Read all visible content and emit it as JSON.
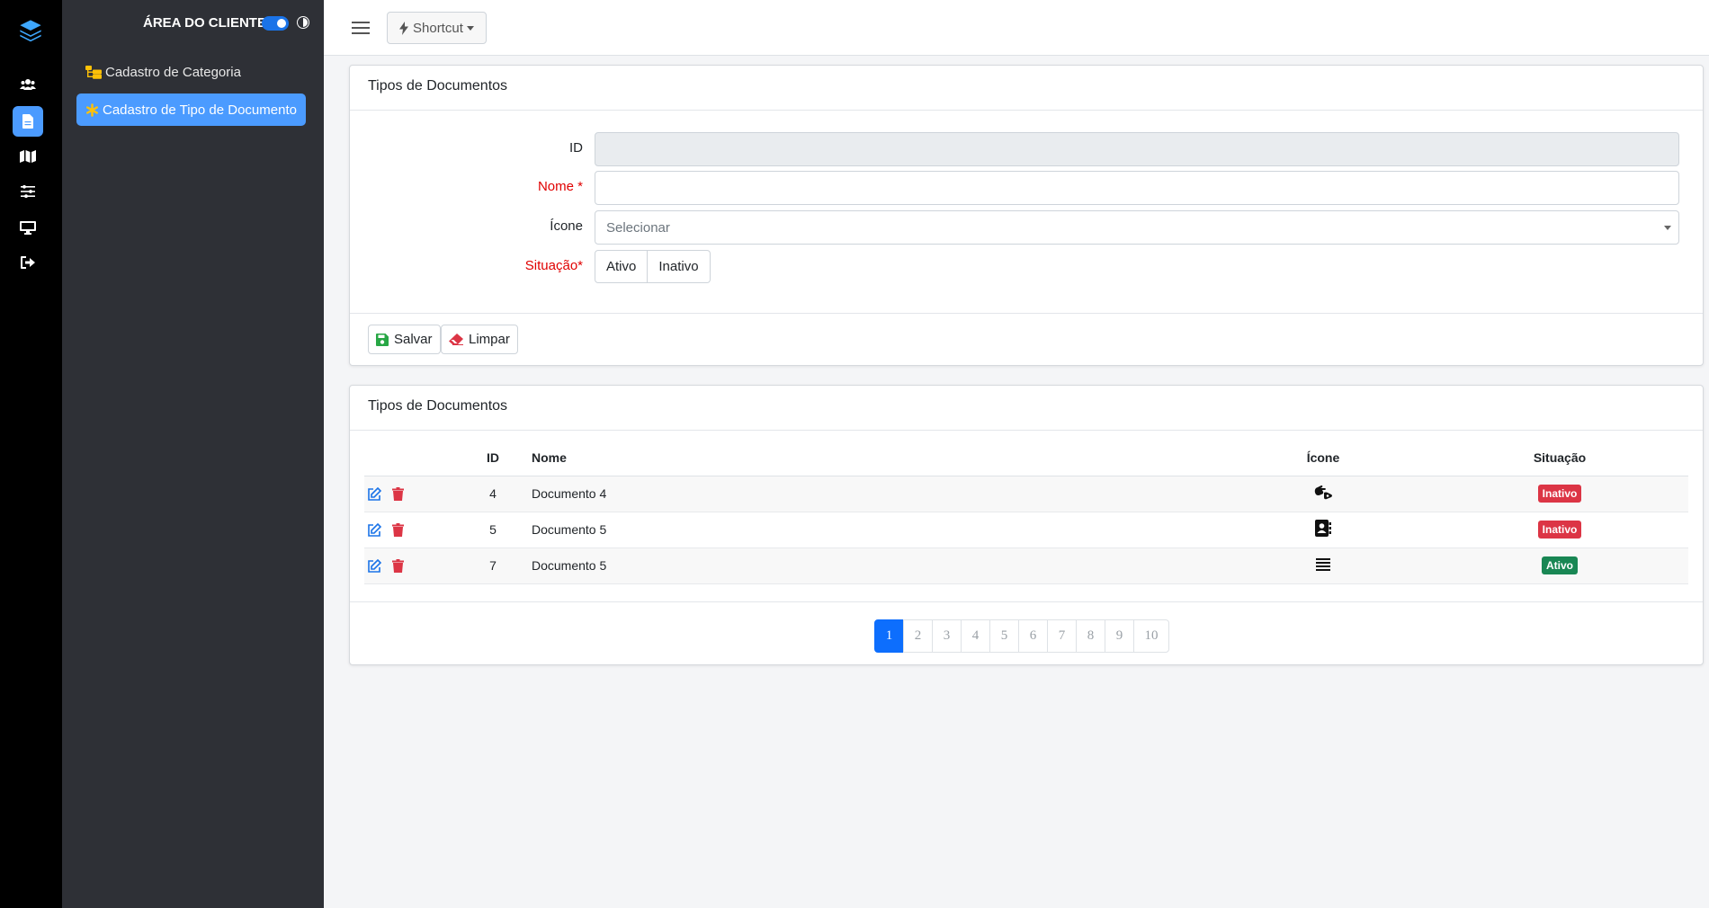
{
  "sidebar": {
    "area_title": "ÁREA DO CLIENTE",
    "items": [
      {
        "label": "Cadastro de Categoria",
        "active": false
      },
      {
        "label": "Cadastro de Tipo de Documento",
        "active": true
      }
    ]
  },
  "rail": {
    "icons": [
      "layers-logo-icon",
      "users-icon",
      "document-icon",
      "map-icon",
      "sliders-icon",
      "monitor-icon",
      "logout-icon"
    ],
    "active": "document-icon"
  },
  "topbar": {
    "shortcut_label": "Shortcut"
  },
  "form": {
    "title": "Tipos de Documentos",
    "fields": {
      "id_label": "ID",
      "id_value": "",
      "nome_label": "Nome *",
      "nome_value": "",
      "icone_label": "Ícone",
      "icone_placeholder": "Selecionar",
      "situacao_label": "Situação*",
      "situacao_options": [
        "Ativo",
        "Inativo"
      ]
    },
    "buttons": {
      "save": "Salvar",
      "clear": "Limpar"
    }
  },
  "list": {
    "title": "Tipos de Documentos",
    "columns": [
      "ID",
      "Nome",
      "Ícone",
      "Situação"
    ],
    "rows": [
      {
        "id": "4",
        "nome": "Documento 4",
        "icon": "sign-language-icon",
        "situacao": "Inativo"
      },
      {
        "id": "5",
        "nome": "Documento 5",
        "icon": "address-book-icon",
        "situacao": "Inativo"
      },
      {
        "id": "7",
        "nome": "Documento 5",
        "icon": "align-justify-icon",
        "situacao": "Ativo"
      }
    ],
    "pagination": [
      "1",
      "2",
      "3",
      "4",
      "5",
      "6",
      "7",
      "8",
      "9",
      "10"
    ],
    "current_page": "1"
  },
  "colors": {
    "accent": "#4b9bff",
    "primary": "#0d6efd",
    "danger": "#dc3545",
    "success": "#198754",
    "required": "#e00000"
  }
}
